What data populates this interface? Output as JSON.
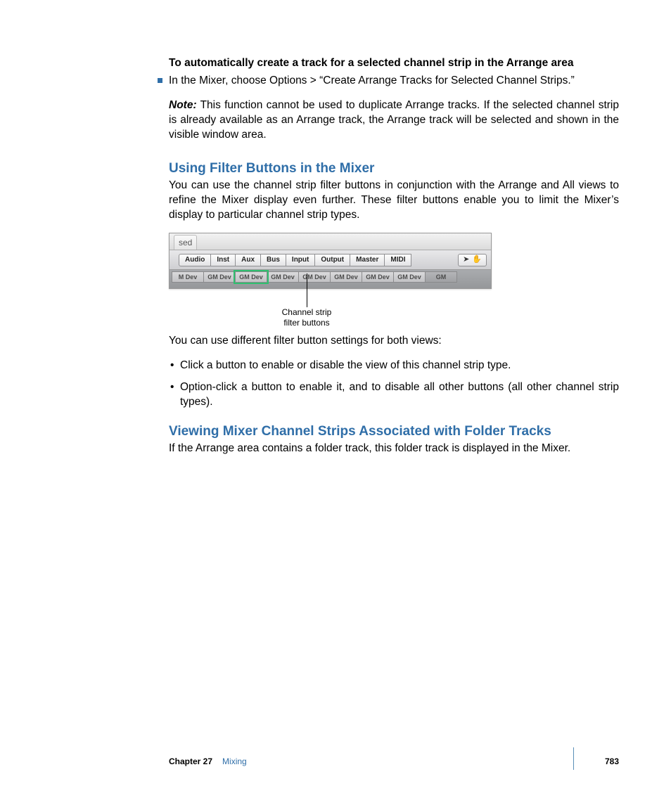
{
  "task_title": "To automatically create a track for a selected channel strip in the Arrange area",
  "step_text": "In the Mixer, choose Options > “Create Arrange Tracks for Selected Channel Strips.”",
  "note_label": "Note:",
  "note_text": " This function cannot be used to duplicate Arrange tracks. If the selected channel strip is already available as an Arrange track, the Arrange track will be selected and shown in the visible window area.",
  "section1_title": "Using Filter Buttons in the Mixer",
  "section1_intro": "You can use the channel strip filter buttons in conjunction with the Arrange and All views to refine the Mixer display even further. These filter buttons enable you to limit the Mixer’s display to particular channel strip types.",
  "figure": {
    "tab_label": "sed",
    "filter_buttons": [
      "Audio",
      "Inst",
      "Aux",
      "Bus",
      "Input",
      "Output",
      "Master",
      "MIDI"
    ],
    "tool_icons": {
      "pointer": "▲",
      "hand": "✋"
    },
    "strips": [
      "M Dev",
      "GM Dev",
      "GM Dev",
      "GM Dev",
      "GM Dev",
      "GM Dev",
      "GM Dev",
      "GM Dev",
      "GM"
    ],
    "highlight_index": 2,
    "callout_line1": "Channel strip",
    "callout_line2": "filter buttons"
  },
  "filter_intro": "You can use different filter button settings for both views:",
  "bullets": [
    "Click a button to enable or disable the view of this channel strip type.",
    "Option-click a button to enable it, and to disable all other buttons (all other channel strip types)."
  ],
  "section2_title": "Viewing Mixer Channel Strips Associated with Folder Tracks",
  "section2_text": "If the Arrange area contains a folder track, this folder track is displayed in the Mixer.",
  "footer": {
    "chapter_label": "Chapter 27",
    "chapter_title": "Mixing",
    "page_number": "783"
  }
}
